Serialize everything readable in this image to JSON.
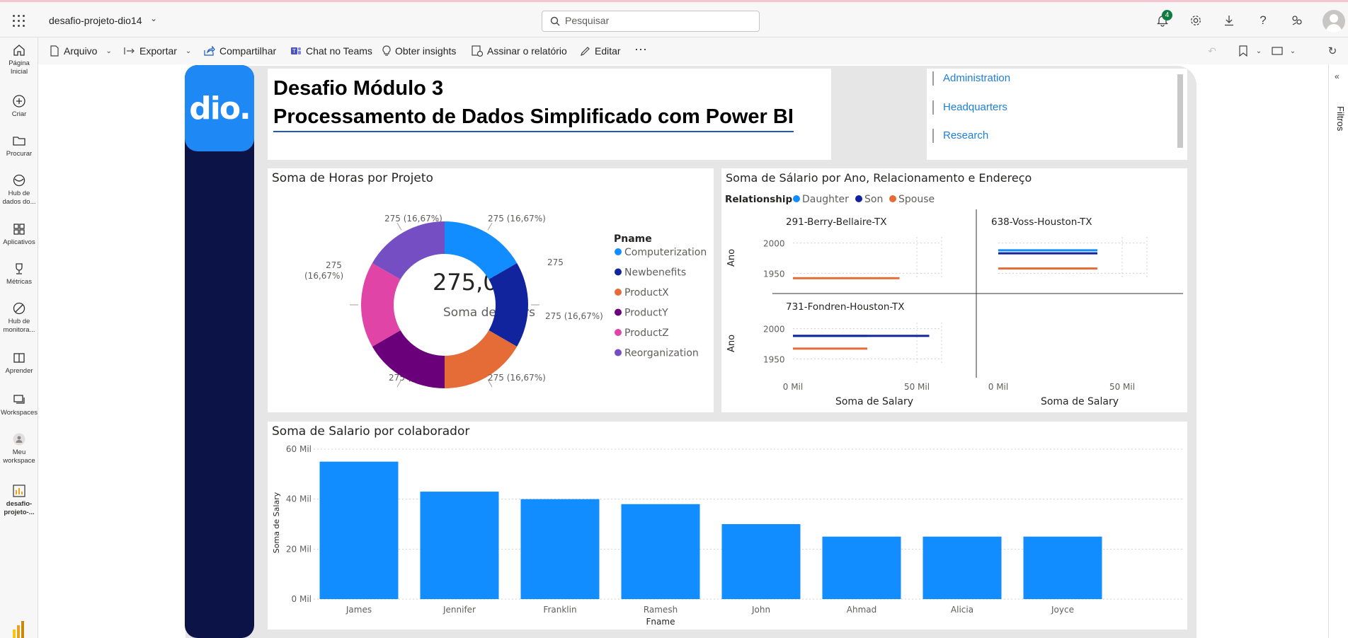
{
  "topbar": {
    "workspace_name": "desafio-projeto-dio14",
    "search_placeholder": "Pesquisar",
    "notification_count": "4"
  },
  "leftnav": {
    "items": [
      {
        "label": "Página\nInicial",
        "icon": "home-icon"
      },
      {
        "label": "Criar",
        "icon": "plus-circle-icon"
      },
      {
        "label": "Procurar",
        "icon": "folder-icon"
      },
      {
        "label": "Hub de\ndados do...",
        "icon": "data-hub-icon"
      },
      {
        "label": "Aplicativos",
        "icon": "apps-icon"
      },
      {
        "label": "Métricas",
        "icon": "trophy-icon"
      },
      {
        "label": "Hub de\nmonitora...",
        "icon": "monitor-hub-icon"
      },
      {
        "label": "Aprender",
        "icon": "book-icon"
      },
      {
        "label": "Workspaces",
        "icon": "workspaces-icon"
      },
      {
        "label": "Meu\nworkspace",
        "icon": "person-icon"
      },
      {
        "label": "desafio-\nprojeto-...",
        "icon": "report-icon"
      }
    ]
  },
  "commandbar": {
    "arquivo": "Arquivo",
    "exportar": "Exportar",
    "compartilhar": "Compartilhar",
    "chat_teams": "Chat no Teams",
    "insights": "Obter insights",
    "assinar": "Assinar o relatório",
    "editar": "Editar",
    "more": "···"
  },
  "rightpane": {
    "filtros": "Filtros"
  },
  "report": {
    "logo_text": "dio.",
    "title_line1": "Desafio Módulo 3",
    "title_line2": "Processamento de Dados Simplificado com Power BI",
    "slicer": [
      "Administration",
      "Headquarters",
      "Research"
    ],
    "donut": {
      "title": "Soma de Horas por Projeto",
      "center_value": "275,00",
      "center_label": "Soma de Hours",
      "legend_title": "Pname",
      "labels": [
        "275 (16,67%)",
        "275 (16,67%)",
        "275 (16,67%)",
        "275 (16,67%)",
        "275 (16,67%)",
        "275 (16,67%)"
      ]
    },
    "small_multiples": {
      "title": "Soma de Sálario por Ano, Relacionamento e Endereço",
      "legend_title": "Relationship",
      "panels": [
        "291-Berry-Bellaire-TX",
        "638-Voss-Houston-TX",
        "731-Fondren-Houston-TX"
      ],
      "y_title": "Ano",
      "x_title": "Soma de Salary",
      "y_ticks": [
        "2000",
        "1950"
      ],
      "x_ticks": [
        "0 Mil",
        "50 Mil"
      ]
    },
    "bar": {
      "title": "Soma de Salario por colaborador",
      "y_title": "Soma de Salary",
      "x_title": "Fname",
      "y_ticks": [
        "60 Mil",
        "40 Mil",
        "20 Mil",
        "0 Mil"
      ]
    }
  },
  "chart_data": [
    {
      "type": "pie",
      "title": "Soma de Horas por Projeto",
      "legend_title": "Pname",
      "categories": [
        "Computerization",
        "Newbenefits",
        "ProductX",
        "ProductY",
        "ProductZ",
        "Reorganization"
      ],
      "values": [
        275,
        275,
        275,
        275,
        275,
        275
      ],
      "colors": [
        "#118dff",
        "#12239e",
        "#e66c37",
        "#6b007b",
        "#e044a7",
        "#744ec2"
      ]
    },
    {
      "type": "bar",
      "orientation": "horizontal",
      "title": "Soma de Sálario por Ano, Relacionamento e Endereço",
      "ylabel": "Ano",
      "xlabel": "Soma de Salary",
      "legend_title": "Relationship",
      "xlim": [
        0,
        60000
      ],
      "ylim": [
        1940,
        2010
      ],
      "series_colors": {
        "Daughter": "#118dff",
        "Son": "#12239e",
        "Spouse": "#e66c37"
      },
      "panels": [
        {
          "name": "291-Berry-Bellaire-TX",
          "series": [
            {
              "name": "Spouse",
              "year": 1942,
              "value": 43000
            }
          ]
        },
        {
          "name": "638-Voss-Houston-TX",
          "series": [
            {
              "name": "Daughter",
              "year": 1988,
              "value": 40000
            },
            {
              "name": "Son",
              "year": 1983,
              "value": 40000
            },
            {
              "name": "Spouse",
              "year": 1958,
              "value": 40000
            }
          ]
        },
        {
          "name": "731-Fondren-Houston-TX",
          "series": [
            {
              "name": "Daughter",
              "year": 1988,
              "value": 30000
            },
            {
              "name": "Son",
              "year": 1988,
              "value": 55000
            },
            {
              "name": "Spouse",
              "year": 1967,
              "value": 30000
            }
          ]
        }
      ]
    },
    {
      "type": "bar",
      "title": "Soma de Salario por colaborador",
      "xlabel": "Fname",
      "ylabel": "Soma de Salary",
      "categories": [
        "James",
        "Jennifer",
        "Franklin",
        "Ramesh",
        "John",
        "Ahmad",
        "Alicia",
        "Joyce"
      ],
      "values": [
        55000,
        43000,
        40000,
        38000,
        30000,
        25000,
        25000,
        25000
      ],
      "ylim": [
        0,
        60000
      ],
      "color": "#118dff"
    }
  ]
}
